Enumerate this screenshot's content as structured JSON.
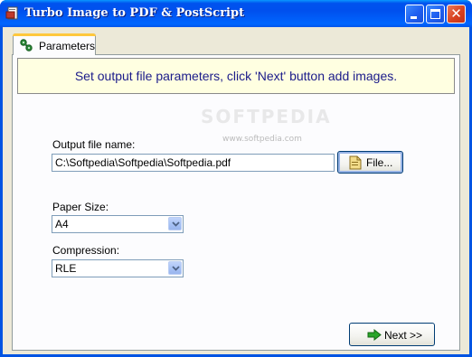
{
  "window": {
    "title": "Turbo Image to PDF & PostScript",
    "icons": {
      "app": "pdf-app-icon",
      "minimize": "minimize-icon",
      "maximize": "maximize-icon",
      "close": "close-icon"
    }
  },
  "tabs": [
    {
      "label": "Parameters",
      "icon": "parameters-icon",
      "selected": true
    }
  ],
  "info": {
    "message": "Set output file parameters, click 'Next'  button add images."
  },
  "output": {
    "label": "Output file name:",
    "value": "C:\\Softpedia\\Softpedia\\Softpedia.pdf",
    "file_button": "File...",
    "file_icon": "folder-document-icon"
  },
  "paper": {
    "label": "Paper Size:",
    "selected": "A4"
  },
  "compression": {
    "label": "Compression:",
    "selected": "RLE"
  },
  "next_button": {
    "label": "Next >>",
    "icon": "green-arrow-right-icon"
  },
  "watermark": {
    "logo": "SOFTPEDIA",
    "url": "www.softpedia.com"
  },
  "colors": {
    "titlebar": "#0054e3",
    "client_bg": "#ece9d8",
    "banner_bg": "#ffffe1",
    "banner_text": "#1b1b8a",
    "tab_highlight": "#ffc83c"
  }
}
